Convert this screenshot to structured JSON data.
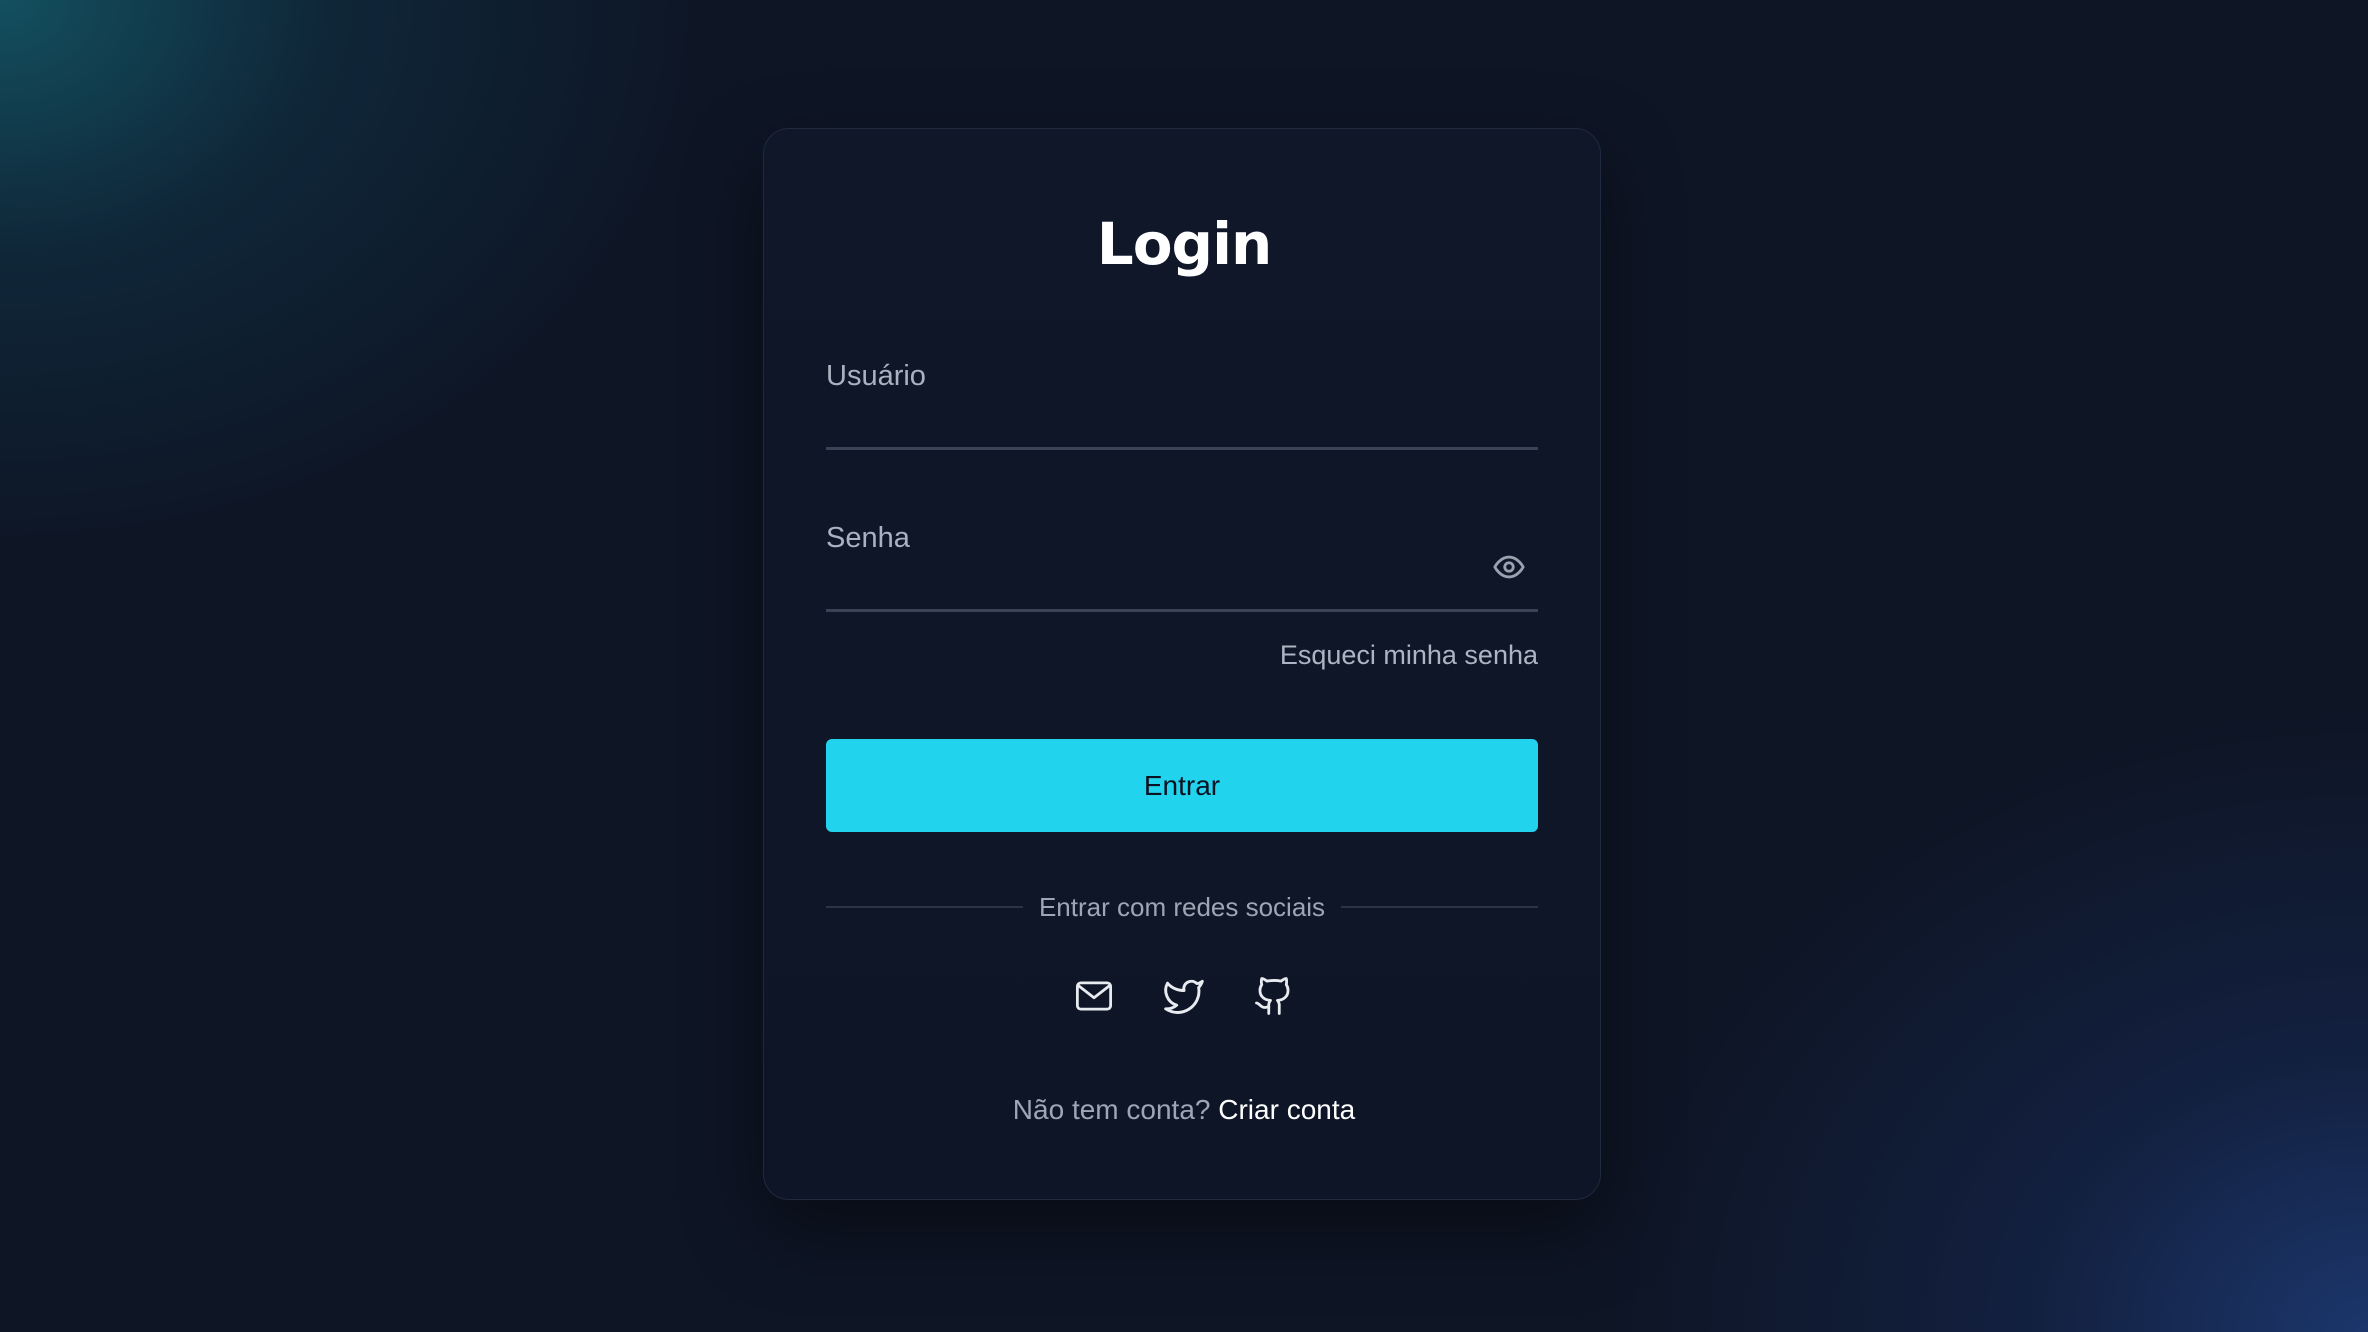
{
  "login": {
    "title": "Login",
    "username": {
      "label": "Usuário",
      "value": ""
    },
    "password": {
      "label": "Senha",
      "value": "",
      "toggle_icon": "eye-icon"
    },
    "forgot_password_link": "Esqueci minha senha",
    "submit_label": "Entrar",
    "social_divider_text": "Entrar com redes sociais",
    "social_providers": [
      {
        "icon": "mail-icon"
      },
      {
        "icon": "twitter-icon"
      },
      {
        "icon": "github-icon"
      }
    ],
    "signup": {
      "prompt": "Não tem conta?",
      "link_label": "Criar conta"
    }
  },
  "colors": {
    "accent": "#22d3ee",
    "card_background": "#0f1729",
    "page_background": "#0e1525",
    "text_primary": "#ffffff",
    "text_muted": "#aab1bf"
  }
}
